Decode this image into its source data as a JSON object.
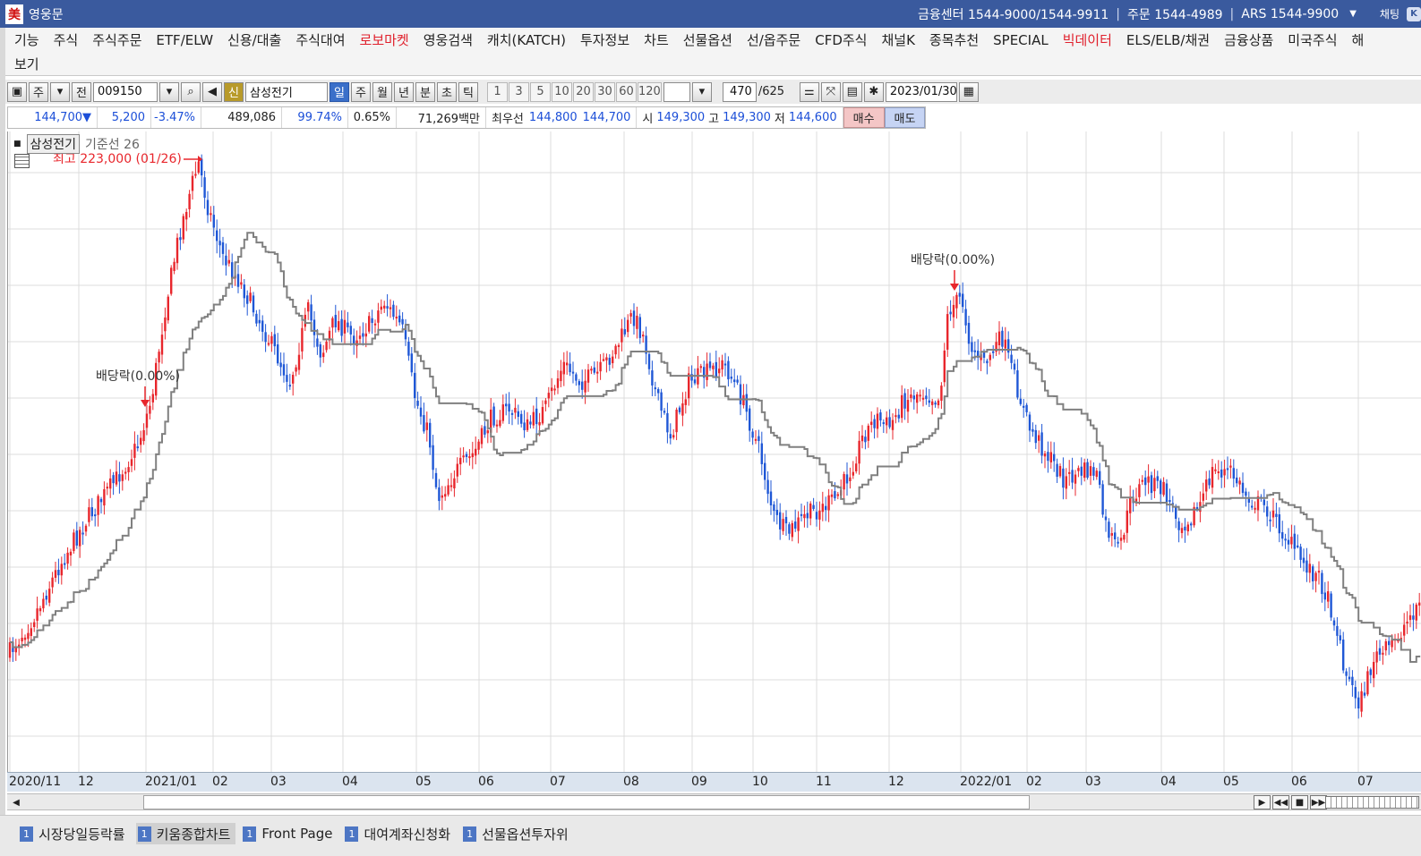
{
  "window": {
    "title": "영웅문",
    "logo_glyph": "美",
    "contact": [
      "금융센터  1544-9000/1544-9911",
      "주문  1544-4989",
      "ARS 1544-9900"
    ],
    "chat_label": "채팅"
  },
  "menu": {
    "row1": [
      {
        "label": "기능",
        "hot": false
      },
      {
        "label": "주식",
        "hot": false
      },
      {
        "label": "주식주문",
        "hot": false
      },
      {
        "label": "ETF/ELW",
        "hot": false
      },
      {
        "label": "신용/대출",
        "hot": false
      },
      {
        "label": "주식대여",
        "hot": false
      },
      {
        "label": "로보마켓",
        "hot": true
      },
      {
        "label": "영웅검색",
        "hot": false
      },
      {
        "label": "캐치(KATCH)",
        "hot": false
      },
      {
        "label": "투자정보",
        "hot": false
      },
      {
        "label": "차트",
        "hot": false
      },
      {
        "label": "선물옵션",
        "hot": false
      },
      {
        "label": "선/옵주문",
        "hot": false
      },
      {
        "label": "CFD주식",
        "hot": false
      },
      {
        "label": "채널K",
        "hot": false
      },
      {
        "label": "종목추천",
        "hot": false
      },
      {
        "label": "SPECIAL",
        "hot": false
      },
      {
        "label": "빅데이터",
        "hot": true
      },
      {
        "label": "ELS/ELB/채권",
        "hot": false
      },
      {
        "label": "금융상품",
        "hot": false
      },
      {
        "label": "미국주식",
        "hot": false
      },
      {
        "label": "해",
        "hot": false
      }
    ],
    "row2": [
      {
        "label": "보기",
        "hot": false
      }
    ]
  },
  "toolbar": {
    "type_label": "주",
    "prev_label": "전",
    "code": "009150",
    "new_label": "신",
    "stock_name": "삼성전기",
    "periods": [
      "일",
      "주",
      "월",
      "년",
      "분",
      "초",
      "틱"
    ],
    "active_period": "일",
    "intervals": [
      "1",
      "3",
      "5",
      "10",
      "20",
      "30",
      "60",
      "120"
    ],
    "count": "470",
    "total": "/625",
    "date": "2023/01/30"
  },
  "quote": {
    "price": "144,700",
    "change": "5,200",
    "change_pct": "-3.47%",
    "volume": "489,086",
    "vol_ratio": "99.74%",
    "turnover": "0.65%",
    "amount": "71,269백만",
    "best_label": "최우선",
    "best_ask": "144,800",
    "best_bid": "144,700",
    "open_label": "시",
    "open": "149,300",
    "high_label": "고",
    "high": "149,300",
    "low_label": "저",
    "low": "144,600",
    "buy_label": "매수",
    "sell_label": "매도"
  },
  "chart": {
    "legend_name": "삼성전기",
    "legend_sub": "기준선 26",
    "high_marker": "최고 223,000 (01/26)",
    "dividend_label": "배당락(0.00%)",
    "up_color": "#e8262c",
    "down_color": "#1f57d6",
    "baseline_color": "#808080",
    "x_ticks": [
      "2020/11",
      "12",
      "2021/01",
      "02",
      "03",
      "04",
      "05",
      "06",
      "07",
      "08",
      "09",
      "10",
      "11",
      "12",
      "2022/01",
      "02",
      "03",
      "04",
      "05",
      "06",
      "07"
    ]
  },
  "chart_data": {
    "type": "candlestick",
    "title": "삼성전기",
    "indicator": "기준선 26",
    "xlabel": "",
    "ylabel": "",
    "x": [
      "2020/11",
      "12",
      "2021/01",
      "02",
      "03",
      "04",
      "05",
      "06",
      "07",
      "08",
      "09",
      "10",
      "11",
      "12",
      "2022/01",
      "02",
      "03",
      "04",
      "05",
      "06",
      "07"
    ],
    "annotations": [
      "최고 223,000 (01/26)",
      "배당락(0.00%)",
      "배당락(0.00%)"
    ],
    "grid": true
  },
  "taskbar": {
    "tabs": [
      {
        "num": "1",
        "label": "시장당일등락률"
      },
      {
        "num": "1",
        "label": "키움종합차트"
      },
      {
        "num": "1",
        "label": "Front Page"
      },
      {
        "num": "1",
        "label": "대여계좌신청화"
      },
      {
        "num": "1",
        "label": "선물옵션투자위"
      }
    ],
    "active": 1
  }
}
